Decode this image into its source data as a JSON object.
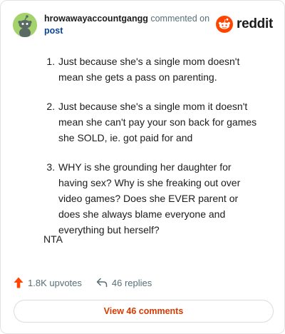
{
  "header": {
    "author": "hrowawayaccountgangg",
    "commented_on": "commented on",
    "post_link": "post",
    "brand": "reddit",
    "avatar_icon": "snoo-avatar-icon",
    "brand_icon": "reddit-logo-icon",
    "colors": {
      "brand": "#ff4500",
      "link": "#0a449b",
      "avatar_bg": "#a4d26c"
    }
  },
  "comment": {
    "items": [
      "Just because she's a single mom doesn't mean she gets a pass on parenting.",
      "Just because she's a single mom it doesn't mean she can't pay your son back for games she SOLD, ie. got paid for and",
      "WHY is she grounding her daughter for having sex? Why is she freaking out over video games? Does she EVER parent or does she always blame everyone and everything but herself?"
    ],
    "closing": "NTA"
  },
  "actions": {
    "upvotes": "1.8K upvotes",
    "replies": "46 replies",
    "upvote_icon": "upvote-arrow-icon",
    "reply_icon": "reply-arrow-icon",
    "colors": {
      "upvote": "#ff4500"
    }
  },
  "footer": {
    "view_comments": "View 46 comments",
    "colors": {
      "text": "#d93a00"
    }
  }
}
